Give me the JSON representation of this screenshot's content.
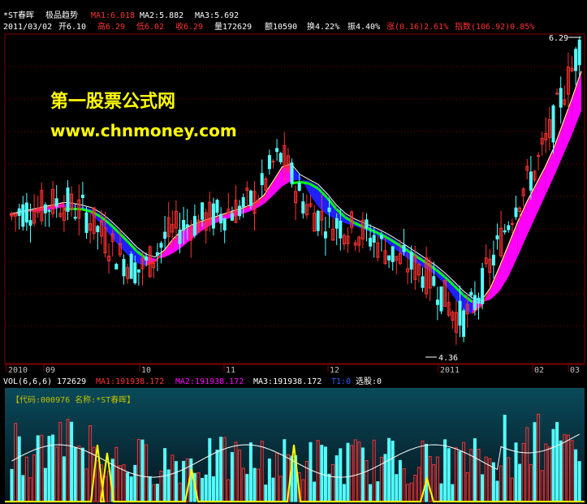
{
  "title": {
    "stock": "*ST春晖",
    "indicator": "极品趋势",
    "ma1": "MA1:6.018",
    "ma2": "MA2:5.882",
    "ma3": "MA3:5.692"
  },
  "quote": {
    "date": "2011/03/02",
    "open": "开6.10",
    "high": "高6.29",
    "low": "低6.02",
    "close": "收6.29",
    "volume": "量172629",
    "amount": "额10590",
    "turnover": "换4.22%",
    "amplitude": "振4.40%",
    "change": "涨(0.16)2.61%",
    "index": "指数(106.92)0.85%"
  },
  "watermark": {
    "line1": "第一股票公式网",
    "line2": "www.chnmoney.com"
  },
  "price_labels": {
    "high": "6.29",
    "low": "4.36"
  },
  "time_axis": [
    "2010",
    "09",
    "10",
    "11",
    "12",
    "2011",
    "02",
    "03"
  ],
  "vol_header": {
    "name": "VOL(6,6,6)",
    "value": "172629",
    "ma1": "MA1:191938.172",
    "ma2": "MA2:191938.172",
    "ma3": "MA3:191938.172",
    "t1": "T1:0",
    "pick": "选股:0"
  },
  "sub_title": "【代码:000976 名称:*ST春晖】",
  "colors": {
    "up": "#ff3232",
    "down": "#54ffff",
    "band_up": "#ff00ff",
    "band_down": "#2020ff",
    "green": "#00ff00",
    "yellow": "#ffff00",
    "grid": "#800000"
  },
  "chart_data": {
    "type": "candlestick",
    "price_range": [
      4.36,
      6.29
    ],
    "close_series": [
      5.15,
      5.18,
      5.2,
      5.19,
      5.22,
      5.24,
      5.23,
      5.2,
      5.18,
      5.1,
      5.02,
      4.95,
      4.88,
      4.83,
      4.79,
      4.82,
      4.9,
      5.0,
      5.05,
      5.08,
      5.1,
      5.12,
      5.14,
      5.16,
      5.18,
      5.2,
      5.22,
      5.26,
      5.35,
      5.5,
      5.55,
      5.42,
      5.28,
      5.2,
      5.15,
      5.12,
      5.1,
      5.08,
      5.06,
      5.04,
      5.0,
      4.95,
      4.9,
      4.85,
      4.82,
      4.8,
      4.75,
      4.7,
      4.6,
      4.5,
      4.45,
      4.52,
      4.65,
      4.8,
      4.95,
      5.1,
      5.25,
      5.35,
      5.45,
      5.6,
      5.75,
      5.95,
      6.1,
      6.29
    ]
  }
}
